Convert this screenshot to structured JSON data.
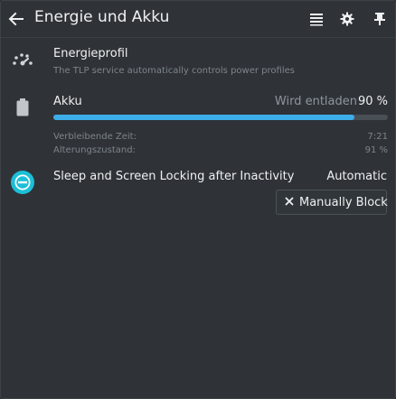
{
  "header": {
    "title": "Energie und Akku"
  },
  "energy_profile": {
    "title": "Energieprofil",
    "description": "The TLP service automatically controls power profiles"
  },
  "battery": {
    "title": "Akku",
    "status": "Wird entladen",
    "percent_label": "90 %",
    "charge_fraction": 0.9,
    "remaining_time_label": "Verbleibende Zeit:",
    "remaining_time_value": "7:21",
    "health_label": "Alterungszustand:",
    "health_value": "91 %"
  },
  "sleep": {
    "title": "Sleep and Screen Locking after Inactivity",
    "mode": "Automatic",
    "block_button_label": "Manually Block"
  },
  "colors": {
    "accent": "#3daee9",
    "background": "#2f3338",
    "text": "#eff0f1",
    "muted_text": "#7d848b"
  },
  "icons": [
    "back-arrow-icon",
    "list-icon",
    "gear-icon",
    "pin-icon",
    "speedometer-icon",
    "battery-icon",
    "inhibit-icon",
    "close-icon"
  ]
}
